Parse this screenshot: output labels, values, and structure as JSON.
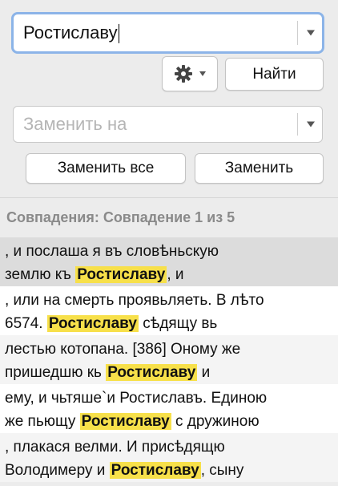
{
  "search": {
    "value": "Ростиславу"
  },
  "replace": {
    "placeholder": "Заменить на"
  },
  "buttons": {
    "find": "Найти",
    "replace_all": "Заменить все",
    "replace": "Заменить"
  },
  "icons": {
    "options": "gear-icon",
    "dropdown": "chevron-down-icon"
  },
  "matches_header": "Совпадения: Совпадение 1 из 5",
  "colors": {
    "highlight": "#f7e04a",
    "selected_row": "#dcdcdc",
    "focus_ring": "#8cb4e8"
  },
  "results": [
    {
      "pre1": ", и послаша я въ словѣньскую",
      "pre2": "землю къ ",
      "match": "Ростиславу",
      "post": ", и"
    },
    {
      "pre1": ", или на смерть проявьляеть.  В лѣто",
      "pre2": "6574. ",
      "match": "Ростиславу",
      "post": " сѣдящу вь"
    },
    {
      "pre1": "лестью котопана.  [386] Оному же",
      "pre2": "пришедшю кь ",
      "match": "Ростиславу",
      "post": " и"
    },
    {
      "pre1": "ему, и чьтяше`и Ростиславъ. Единою",
      "pre2": "же пьющу ",
      "match": "Ростиславу",
      "post": " с дружиною"
    },
    {
      "pre1": ", плакася велми. И присѣдящю",
      "pre2": "Володимеру и ",
      "match": "Ростиславу",
      "post": ", сыну"
    }
  ]
}
